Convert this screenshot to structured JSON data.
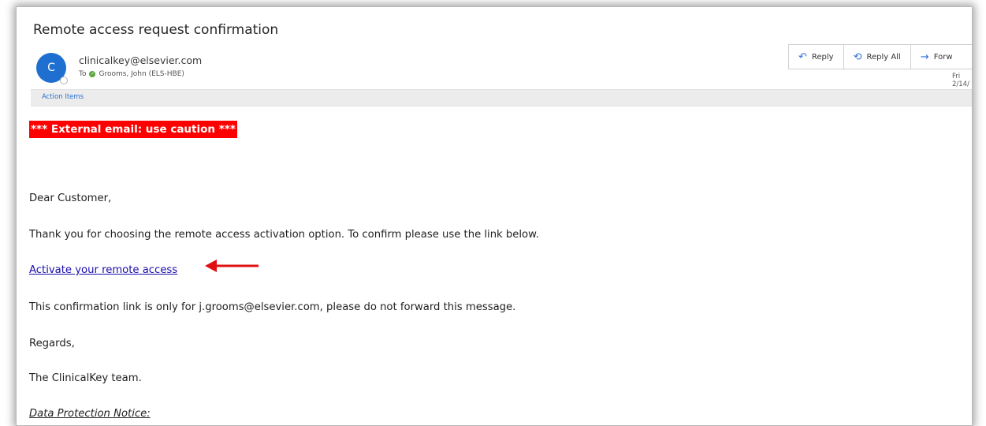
{
  "email": {
    "subject": "Remote access request confirmation",
    "avatar_initial": "C",
    "sender": "clinicalkey@elsevier.com",
    "to_label": "To",
    "recipient": "Grooms, John (ELS-HBE)",
    "date": "Fri 2/14/",
    "action_items": "Action Items",
    "actions": {
      "reply": "Reply",
      "reply_all": "Reply All",
      "forward": "Forw"
    }
  },
  "body": {
    "caution_banner": "*** External email: use caution ***",
    "greeting": "Dear Customer,",
    "intro": "Thank you for choosing the remote access activation option. To confirm please use the link below.",
    "activation_link": "Activate your remote access",
    "notice": "This confirmation link is only for j.grooms@elsevier.com, please do not forward this message.",
    "regards": "Regards,",
    "signature": "The ClinicalKey team.",
    "data_protection": "Data Protection Notice:"
  },
  "icons": {
    "reply": "reply-icon",
    "reply_all": "reply-all-icon",
    "forward": "forward-icon",
    "annotation_arrow": "red-arrow-icon"
  },
  "colors": {
    "caution_bg": "#ff0000",
    "avatar_bg": "#1f6fd1",
    "link": "#1a0dab",
    "accent": "#2b6fd6",
    "annotation_arrow": "#e01010"
  }
}
